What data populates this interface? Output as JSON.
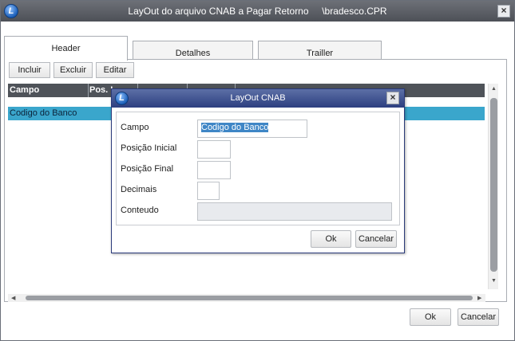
{
  "window": {
    "title": "LayOut do arquivo CNAB a Pagar Retorno     \\bradesco.CPR",
    "close_glyph": "×"
  },
  "tabs": [
    {
      "label": "Header",
      "active": true
    },
    {
      "label": "Detalhes",
      "active": false
    },
    {
      "label": "Trailler",
      "active": false
    }
  ],
  "toolbar": {
    "incluir_label": "Incluir",
    "excluir_label": "Excluir",
    "editar_label": "Editar"
  },
  "grid": {
    "columns": [
      "Campo",
      "Pos. I",
      "",
      "",
      ""
    ],
    "rows": [
      {
        "campo": "Codigo do Banco",
        "selected": true
      }
    ]
  },
  "footer": {
    "ok_label": "Ok",
    "cancel_label": "Cancelar"
  },
  "dialog": {
    "title": "LayOut CNAB",
    "close_glyph": "×",
    "fields": {
      "campo": {
        "label": "Campo",
        "value": "Codigo do Banco"
      },
      "posicao_inicial": {
        "label": "Posição Inicial",
        "value": ""
      },
      "posicao_final": {
        "label": "Posição Final",
        "value": ""
      },
      "decimais": {
        "label": "Decimais",
        "value": ""
      },
      "conteudo": {
        "label": "Conteudo",
        "value": ""
      }
    },
    "ok_label": "Ok",
    "cancel_label": "Cancelar"
  },
  "colors": {
    "titlebar": "#5a5d64",
    "grid_header": "#4f5359",
    "row_selected": "#3aa6cc",
    "dialog_titlebar": "#2d3f80",
    "selection_highlight": "#3f86c6"
  },
  "icons": {
    "app_logo": "logo-icon",
    "close": "close-icon",
    "scroll_up": "chevron-up-icon",
    "scroll_down": "chevron-down-icon",
    "scroll_left": "chevron-left-icon",
    "scroll_right": "chevron-right-icon"
  }
}
